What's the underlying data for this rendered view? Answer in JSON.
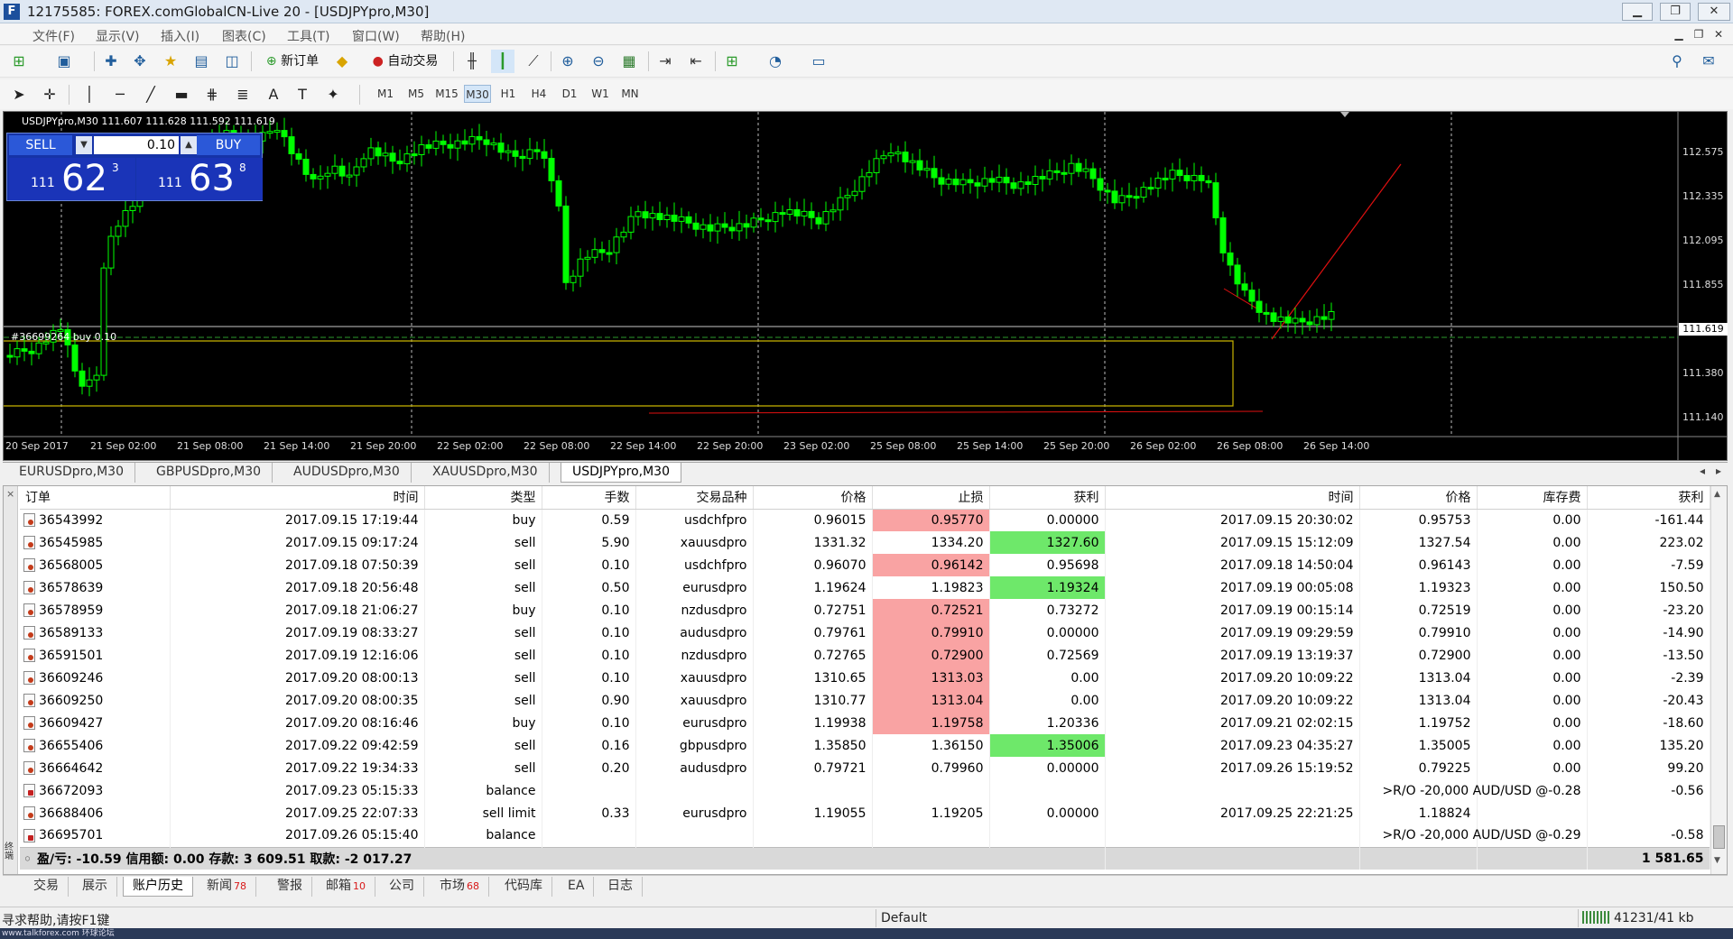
{
  "window": {
    "title": "12175585: FOREX.comGlobalCN-Live 20 - [USDJPYpro,M30]",
    "app_icon": "F",
    "controls": [
      "minimize-icon",
      "restore-icon",
      "close-icon"
    ]
  },
  "menu": [
    "文件(F)",
    "显示(V)",
    "插入(I)",
    "图表(C)",
    "工具(T)",
    "窗口(W)",
    "帮助(H)"
  ],
  "toolbar": {
    "new_order": "新订单",
    "auto_trading": "自动交易",
    "timeframes": [
      "M1",
      "M5",
      "M15",
      "M30",
      "H1",
      "H4",
      "D1",
      "W1",
      "MN"
    ],
    "active_timeframe": "M30"
  },
  "chart": {
    "symbol_info": "USDJPYpro,M30  111.607 111.628 111.592 111.619",
    "trade_panel": {
      "sell_label": "SELL",
      "buy_label": "BUY",
      "lot": "0.10",
      "sell_prefix": "111",
      "sell_big": "62",
      "sell_sup": "3",
      "buy_prefix": "111",
      "buy_big": "63",
      "buy_sup": "8"
    },
    "order_label": "#36699264 buy 0.10",
    "current_price": "111.619",
    "y_ticks": [
      "112.575",
      "112.335",
      "112.095",
      "111.855",
      "111.380",
      "111.140"
    ],
    "x_ticks": [
      "20 Sep 2017",
      "21 Sep 02:00",
      "21 Sep 08:00",
      "21 Sep 14:00",
      "21 Sep 20:00",
      "22 Sep 02:00",
      "22 Sep 08:00",
      "22 Sep 14:00",
      "22 Sep 20:00",
      "23 Sep 02:00",
      "25 Sep 08:00",
      "25 Sep 14:00",
      "25 Sep 20:00",
      "26 Sep 02:00",
      "26 Sep 08:00",
      "26 Sep 14:00"
    ],
    "colors": {
      "background": "#000000",
      "candle": "#00ff00",
      "order_line": "#c8b400",
      "trend_line": "#e01010"
    }
  },
  "chart_tabs": [
    "EURUSDpro,M30",
    "GBPUSDpro,M30",
    "AUDUSDpro,M30",
    "XAUUSDpro,M30",
    "USDJPYpro,M30"
  ],
  "active_chart_tab": "USDJPYpro,M30",
  "history": {
    "columns": [
      "订单",
      "时间",
      "类型",
      "手数",
      "交易品种",
      "价格",
      "止损",
      "获利",
      "时间",
      "价格",
      "库存费",
      "获利"
    ],
    "rows": [
      [
        "36543992",
        "2017.09.15 17:19:44",
        "buy",
        "0.59",
        "usdchfpro",
        "0.96015",
        "0.95770",
        "0.00000",
        "2017.09.15 20:30:02",
        "0.95753",
        "0.00",
        "-161.44"
      ],
      [
        "36545985",
        "2017.09.15 09:17:24",
        "sell",
        "5.90",
        "xauusdpro",
        "1331.32",
        "1334.20",
        "1327.60",
        "2017.09.15 15:12:09",
        "1327.54",
        "0.00",
        "223.02"
      ],
      [
        "36568005",
        "2017.09.18 07:50:39",
        "sell",
        "0.10",
        "usdchfpro",
        "0.96070",
        "0.96142",
        "0.95698",
        "2017.09.18 14:50:04",
        "0.96143",
        "0.00",
        "-7.59"
      ],
      [
        "36578639",
        "2017.09.18 20:56:48",
        "sell",
        "0.50",
        "eurusdpro",
        "1.19624",
        "1.19823",
        "1.19324",
        "2017.09.19 00:05:08",
        "1.19323",
        "0.00",
        "150.50"
      ],
      [
        "36578959",
        "2017.09.18 21:06:27",
        "buy",
        "0.10",
        "nzdusdpro",
        "0.72751",
        "0.72521",
        "0.73272",
        "2017.09.19 00:15:14",
        "0.72519",
        "0.00",
        "-23.20"
      ],
      [
        "36589133",
        "2017.09.19 08:33:27",
        "sell",
        "0.10",
        "audusdpro",
        "0.79761",
        "0.79910",
        "0.00000",
        "2017.09.19 09:29:59",
        "0.79910",
        "0.00",
        "-14.90"
      ],
      [
        "36591501",
        "2017.09.19 12:16:06",
        "sell",
        "0.10",
        "nzdusdpro",
        "0.72765",
        "0.72900",
        "0.72569",
        "2017.09.19 13:19:37",
        "0.72900",
        "0.00",
        "-13.50"
      ],
      [
        "36609246",
        "2017.09.20 08:00:13",
        "sell",
        "0.10",
        "xauusdpro",
        "1310.65",
        "1313.03",
        "0.00",
        "2017.09.20 10:09:22",
        "1313.04",
        "0.00",
        "-2.39"
      ],
      [
        "36609250",
        "2017.09.20 08:00:35",
        "sell",
        "0.90",
        "xauusdpro",
        "1310.77",
        "1313.04",
        "0.00",
        "2017.09.20 10:09:22",
        "1313.04",
        "0.00",
        "-20.43"
      ],
      [
        "36609427",
        "2017.09.20 08:16:46",
        "buy",
        "0.10",
        "eurusdpro",
        "1.19938",
        "1.19758",
        "1.20336",
        "2017.09.21 02:02:15",
        "1.19752",
        "0.00",
        "-18.60"
      ],
      [
        "36655406",
        "2017.09.22 09:42:59",
        "sell",
        "0.16",
        "gbpusdpro",
        "1.35850",
        "1.36150",
        "1.35006",
        "2017.09.23 04:35:27",
        "1.35005",
        "0.00",
        "135.20"
      ],
      [
        "36664642",
        "2017.09.22 19:34:33",
        "sell",
        "0.20",
        "audusdpro",
        "0.79721",
        "0.79960",
        "0.00000",
        "2017.09.26 15:19:52",
        "0.79225",
        "0.00",
        "99.20"
      ]
    ],
    "highlights": [
      [
        "red",
        ""
      ],
      [
        "",
        "green"
      ],
      [
        "red",
        ""
      ],
      [
        "",
        "green"
      ],
      [
        "red",
        ""
      ],
      [
        "red",
        ""
      ],
      [
        "red",
        ""
      ],
      [
        "red",
        ""
      ],
      [
        "red",
        ""
      ],
      [
        "red",
        ""
      ],
      [
        "",
        "green"
      ],
      [
        "",
        ""
      ]
    ],
    "special_rows": [
      {
        "order": "36672093",
        "time": "2017.09.23 05:15:33",
        "type": "balance",
        "comment": ">R/O -20,000 AUD/USD @-0.28",
        "profit": "-0.56"
      },
      {
        "order": "36688406",
        "time": "2017.09.25 22:07:33",
        "type": "sell limit",
        "lots": "0.33",
        "symbol": "eurusdpro",
        "price": "1.19055",
        "sl": "1.19205",
        "tp": "0.00000",
        "time2": "2017.09.25 22:21:25",
        "price2": "1.18824"
      },
      {
        "order": "36695701",
        "time": "2017.09.26 05:15:40",
        "type": "balance",
        "comment": ">R/O -20,000 AUD/USD @-0.29",
        "profit": "-0.58"
      }
    ],
    "summary": {
      "text": "盈/亏: -10.59  信用额: 0.00  存款: 3 609.51  取款: -2 017.27",
      "total": "1 581.65"
    }
  },
  "terminal_side_label": "终端",
  "bottom_tabs": [
    {
      "label": "交易",
      "count": ""
    },
    {
      "label": "展示",
      "count": ""
    },
    {
      "label": "账户历史",
      "count": ""
    },
    {
      "label": "新闻",
      "count": "78"
    },
    {
      "label": "警报",
      "count": ""
    },
    {
      "label": "邮箱",
      "count": "10"
    },
    {
      "label": "公司",
      "count": ""
    },
    {
      "label": "市场",
      "count": "68"
    },
    {
      "label": "代码库",
      "count": ""
    },
    {
      "label": "EA",
      "count": ""
    },
    {
      "label": "日志",
      "count": ""
    }
  ],
  "active_bottom_tab": "账户历史",
  "status": {
    "help": "寻求帮助,请按F1键",
    "profile": "Default",
    "traffic": "41231/41 kb",
    "watermark": "www.talkforex.com 环球论坛"
  }
}
